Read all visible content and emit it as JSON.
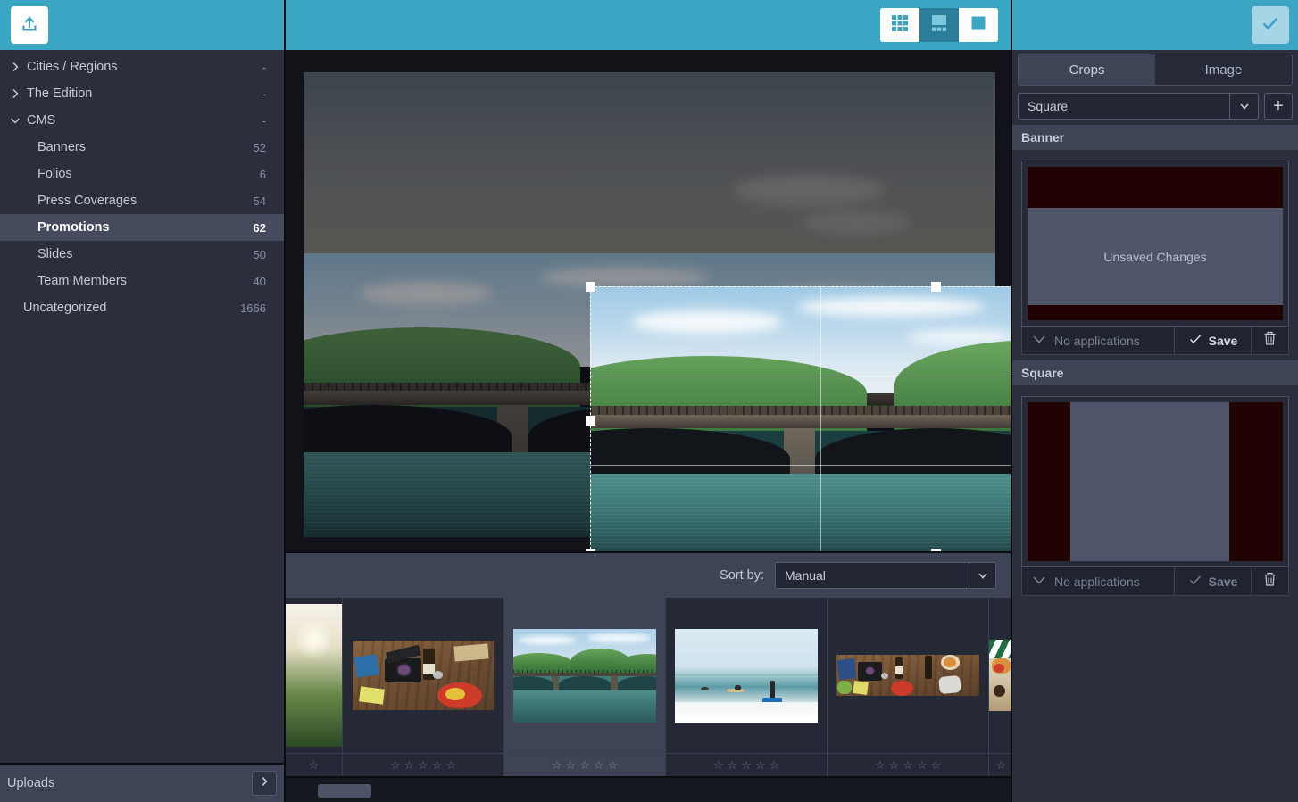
{
  "colors": {
    "teal": "#3ba5c4",
    "sidebar_bg": "#2b2f3c",
    "panel_bg": "#3e4455",
    "selected_row": "#454a5c",
    "crop_letterbox": "#220303",
    "crop_fill": "#4f566b"
  },
  "sidebar": {
    "upload_icon": "upload-icon",
    "items": [
      {
        "label": "Cities / Regions",
        "count": "-",
        "level": "group",
        "expanded": false,
        "selected": false,
        "icon": "chevron-right-icon"
      },
      {
        "label": "The Edition",
        "count": "-",
        "level": "group",
        "expanded": false,
        "selected": false,
        "icon": "chevron-right-icon"
      },
      {
        "label": "CMS",
        "count": "-",
        "level": "group",
        "expanded": true,
        "selected": false,
        "icon": "chevron-down-icon"
      },
      {
        "label": "Banners",
        "count": "52",
        "level": "child",
        "selected": false
      },
      {
        "label": "Folios",
        "count": "6",
        "level": "child",
        "selected": false
      },
      {
        "label": "Press Coverages",
        "count": "54",
        "level": "child",
        "selected": false
      },
      {
        "label": "Promotions",
        "count": "62",
        "level": "child",
        "selected": true
      },
      {
        "label": "Slides",
        "count": "50",
        "level": "child",
        "selected": false
      },
      {
        "label": "Team Members",
        "count": "40",
        "level": "child",
        "selected": false
      },
      {
        "label": "Uncategorized",
        "count": "1666",
        "level": "leaf-root",
        "selected": false
      }
    ],
    "footer": {
      "label": "Uploads",
      "button_icon": "chevron-right-icon"
    }
  },
  "toolbar": {
    "view_modes": [
      {
        "name": "grid-view",
        "icon": "grid-icon",
        "active": false
      },
      {
        "name": "split-view",
        "icon": "split-view-icon",
        "active": true
      },
      {
        "name": "single-view",
        "icon": "single-view-icon",
        "active": false
      }
    ],
    "confirm_icon": "check-icon"
  },
  "viewer": {
    "crop_handles": [
      "top-left",
      "top-center",
      "top-right",
      "middle-left",
      "middle-right",
      "bottom-left",
      "bottom-center",
      "bottom-right"
    ],
    "grid_overlay": "rule-of-thirds"
  },
  "sortbar": {
    "label": "Sort by:",
    "value": "Manual",
    "arrow_icon": "chevron-down-icon"
  },
  "filmstrip": {
    "rating_empty_star": "☆",
    "star_count": 5,
    "items": [
      {
        "name": "thumb-forest-sunrise",
        "selected": false,
        "partial": "left"
      },
      {
        "name": "thumb-flatlay-camera",
        "selected": false,
        "partial": "none"
      },
      {
        "name": "thumb-bridge-lake",
        "selected": true,
        "partial": "none"
      },
      {
        "name": "thumb-beach-surfers",
        "selected": false,
        "partial": "none"
      },
      {
        "name": "thumb-flatlay-wide",
        "selected": false,
        "partial": "none"
      },
      {
        "name": "thumb-flatlay-edge",
        "selected": false,
        "partial": "right"
      }
    ]
  },
  "right_panel": {
    "tabs": [
      {
        "label": "Crops",
        "active": true
      },
      {
        "label": "Image",
        "active": false
      }
    ],
    "crop_select": {
      "value": "Square",
      "arrow_icon": "chevron-down-icon"
    },
    "add_button": {
      "label": "+",
      "icon": "plus-icon"
    },
    "crops": [
      {
        "title": "Banner",
        "preview_text": "Unsaved Changes",
        "orientation": "horizontal",
        "applications_label": "No applications",
        "save_label": "Save",
        "save_enabled": true,
        "delete_icon": "trash-icon",
        "applications_icon": "chevron-down-icon",
        "save_icon": "check-icon"
      },
      {
        "title": "Square",
        "preview_text": "",
        "orientation": "vertical",
        "applications_label": "No applications",
        "save_label": "Save",
        "save_enabled": false,
        "delete_icon": "trash-icon",
        "applications_icon": "chevron-down-icon",
        "save_icon": "check-icon"
      }
    ]
  }
}
